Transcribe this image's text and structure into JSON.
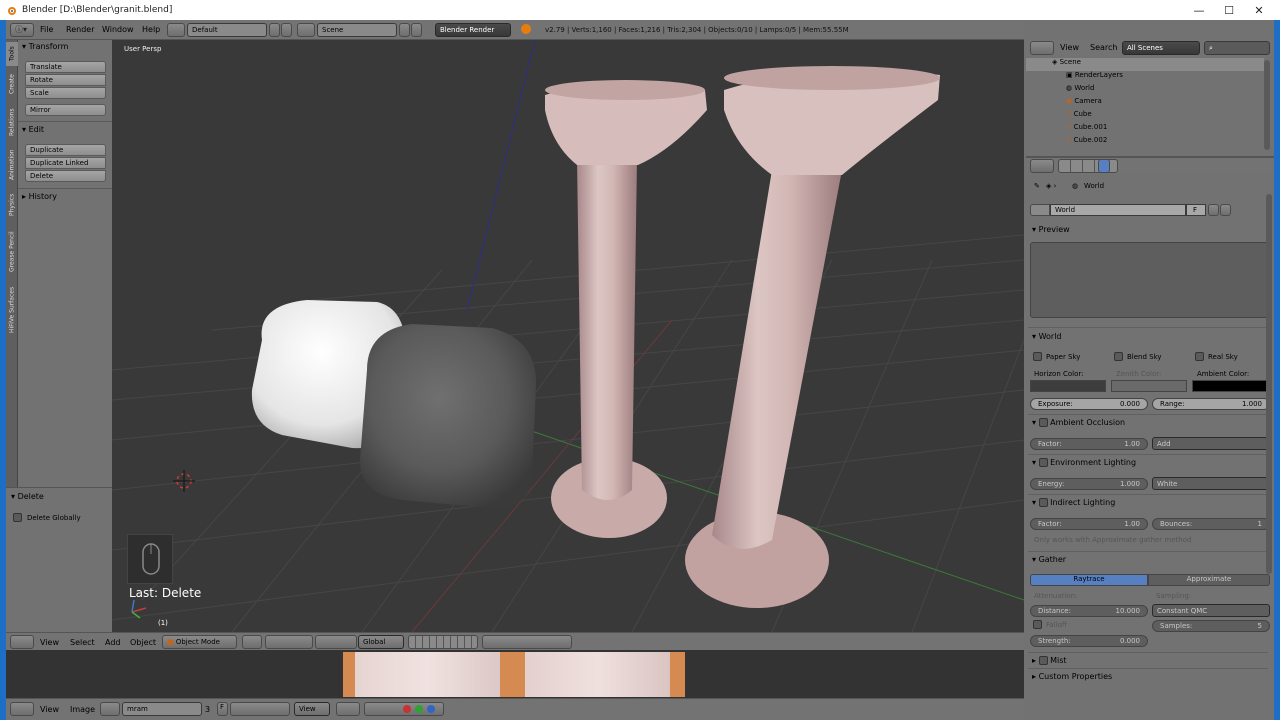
{
  "window": {
    "title": "Blender [D:\\Blender\\granit.blend]"
  },
  "info_header": {
    "menus": [
      "File",
      "Render",
      "Window",
      "Help"
    ],
    "screen_layout": "Default",
    "scene": "Scene",
    "render_engine": "Blender Render",
    "stats": "v2.79 | Verts:1,160 | Faces:1,216 | Tris:2,304 | Objects:0/10 | Lamps:0/5 | Mem:55.55M"
  },
  "tool_tabs": [
    "Tools",
    "Create",
    "Relations",
    "Animation",
    "Physics",
    "Grease Pencil",
    "HiFiVe Surfaces"
  ],
  "tool_shelf": {
    "transform": {
      "title": "Transform",
      "buttons": [
        "Translate",
        "Rotate",
        "Scale"
      ],
      "mirror": "Mirror"
    },
    "edit": {
      "title": "Edit",
      "buttons": [
        "Duplicate",
        "Duplicate Linked",
        "Delete"
      ]
    },
    "history": {
      "title": "History"
    }
  },
  "operator_panel": {
    "title": "Delete",
    "checkbox": "Delete Globally"
  },
  "viewport": {
    "view_label": "User Persp",
    "last_op": "Last: Delete",
    "frame": "(1)"
  },
  "view3d_header": {
    "menus": [
      "View",
      "Select",
      "Add",
      "Object"
    ],
    "mode": "Object Mode",
    "orientation": "Global"
  },
  "image_header": {
    "menus": [
      "View",
      "Image"
    ],
    "image_name": "mram",
    "users": "3",
    "fake": "F",
    "view": "View"
  },
  "outliner": {
    "menus": [
      "View",
      "Search"
    ],
    "display_mode": "All Scenes",
    "items": [
      {
        "label": "Scene",
        "indent": 0,
        "icon": "scene-icon"
      },
      {
        "label": "RenderLayers",
        "indent": 1,
        "icon": "render-layers-icon"
      },
      {
        "label": "World",
        "indent": 1,
        "icon": "world-icon"
      },
      {
        "label": "Camera",
        "indent": 1,
        "icon": "camera-icon"
      },
      {
        "label": "Cube",
        "indent": 1,
        "icon": "mesh-icon"
      },
      {
        "label": "Cube.001",
        "indent": 1,
        "icon": "mesh-icon"
      },
      {
        "label": "Cube.002",
        "indent": 1,
        "icon": "mesh-icon"
      }
    ]
  },
  "properties": {
    "breadcrumb": "World",
    "datablock": {
      "name": "World",
      "fake": "F"
    },
    "preview": {
      "title": "Preview"
    },
    "world": {
      "title": "World",
      "paper_sky": "Paper Sky",
      "blend_sky": "Blend Sky",
      "real_sky": "Real Sky",
      "horizon": "Horizon Color:",
      "zenith": "Zenith Color:",
      "ambient": "Ambient Color:",
      "horizon_color": "#3d3d3d",
      "zenith_color": "#6a6a6a",
      "ambient_color": "#000000",
      "exposure_label": "Exposure:",
      "exposure": "0.000",
      "range_label": "Range:",
      "range": "1.000"
    },
    "ao": {
      "title": "Ambient Occlusion",
      "factor_label": "Factor:",
      "factor": "1.00",
      "blend": "Add"
    },
    "env": {
      "title": "Environment Lighting",
      "energy_label": "Energy:",
      "energy": "1.000",
      "color": "White"
    },
    "indirect": {
      "title": "Indirect Lighting",
      "factor_label": "Factor:",
      "factor": "1.00",
      "bounces_label": "Bounces:",
      "bounces": "1",
      "note": "Only works with Approximate gather method"
    },
    "gather": {
      "title": "Gather",
      "raytrace": "Raytrace",
      "approximate": "Approximate",
      "attenuation": "Attenuation:",
      "sampling": "Sampling:",
      "distance_label": "Distance:",
      "distance": "10.000",
      "method": "Constant QMC",
      "falloff": "Falloff",
      "samples_label": "Samples:",
      "samples": "5",
      "strength_label": "Strength:",
      "strength": "0.000"
    },
    "mist": {
      "title": "Mist"
    },
    "custom": {
      "title": "Custom Properties"
    }
  }
}
